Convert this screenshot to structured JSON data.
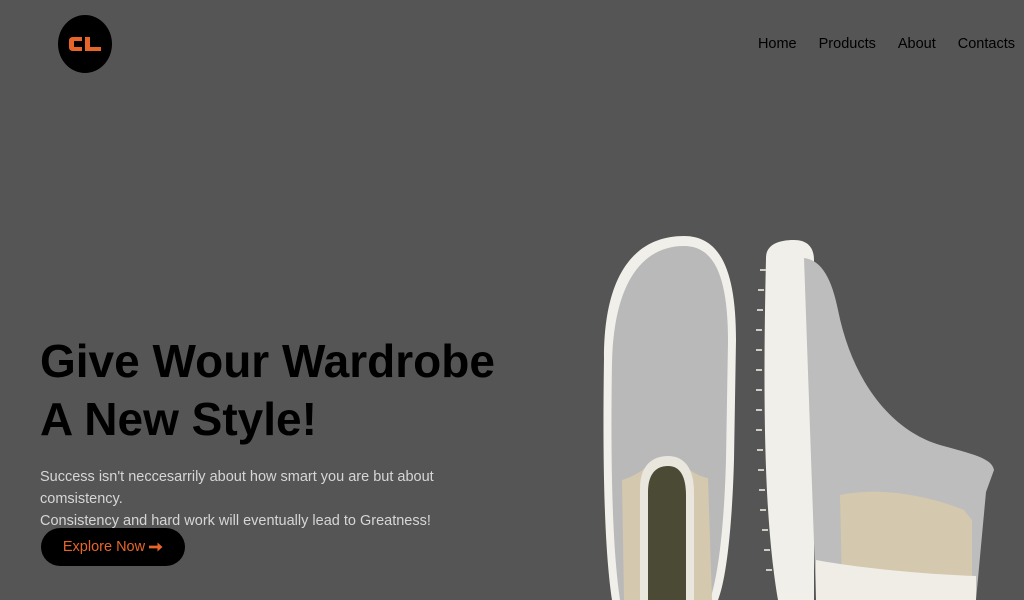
{
  "brand": {
    "logo_text": "CL",
    "accent": "#e8652a"
  },
  "nav": {
    "items": [
      {
        "label": "Home"
      },
      {
        "label": "Products"
      },
      {
        "label": "About"
      },
      {
        "label": "Contacts"
      }
    ]
  },
  "hero": {
    "headline_line1": "Give Wour Wardrobe",
    "headline_line2": "A New Style!",
    "tagline_line1": "Success isn't neccesarrily about how smart you are but about comsistency.",
    "tagline_line2": "Consistency and hard work will eventually lead to Greatness!",
    "cta_label": "Explore Now",
    "cta_icon": "arrow-right-icon"
  },
  "colors": {
    "background": "#555555",
    "text_dark": "#000000",
    "tagline": "#d6d6d6",
    "button_bg": "#000000"
  }
}
